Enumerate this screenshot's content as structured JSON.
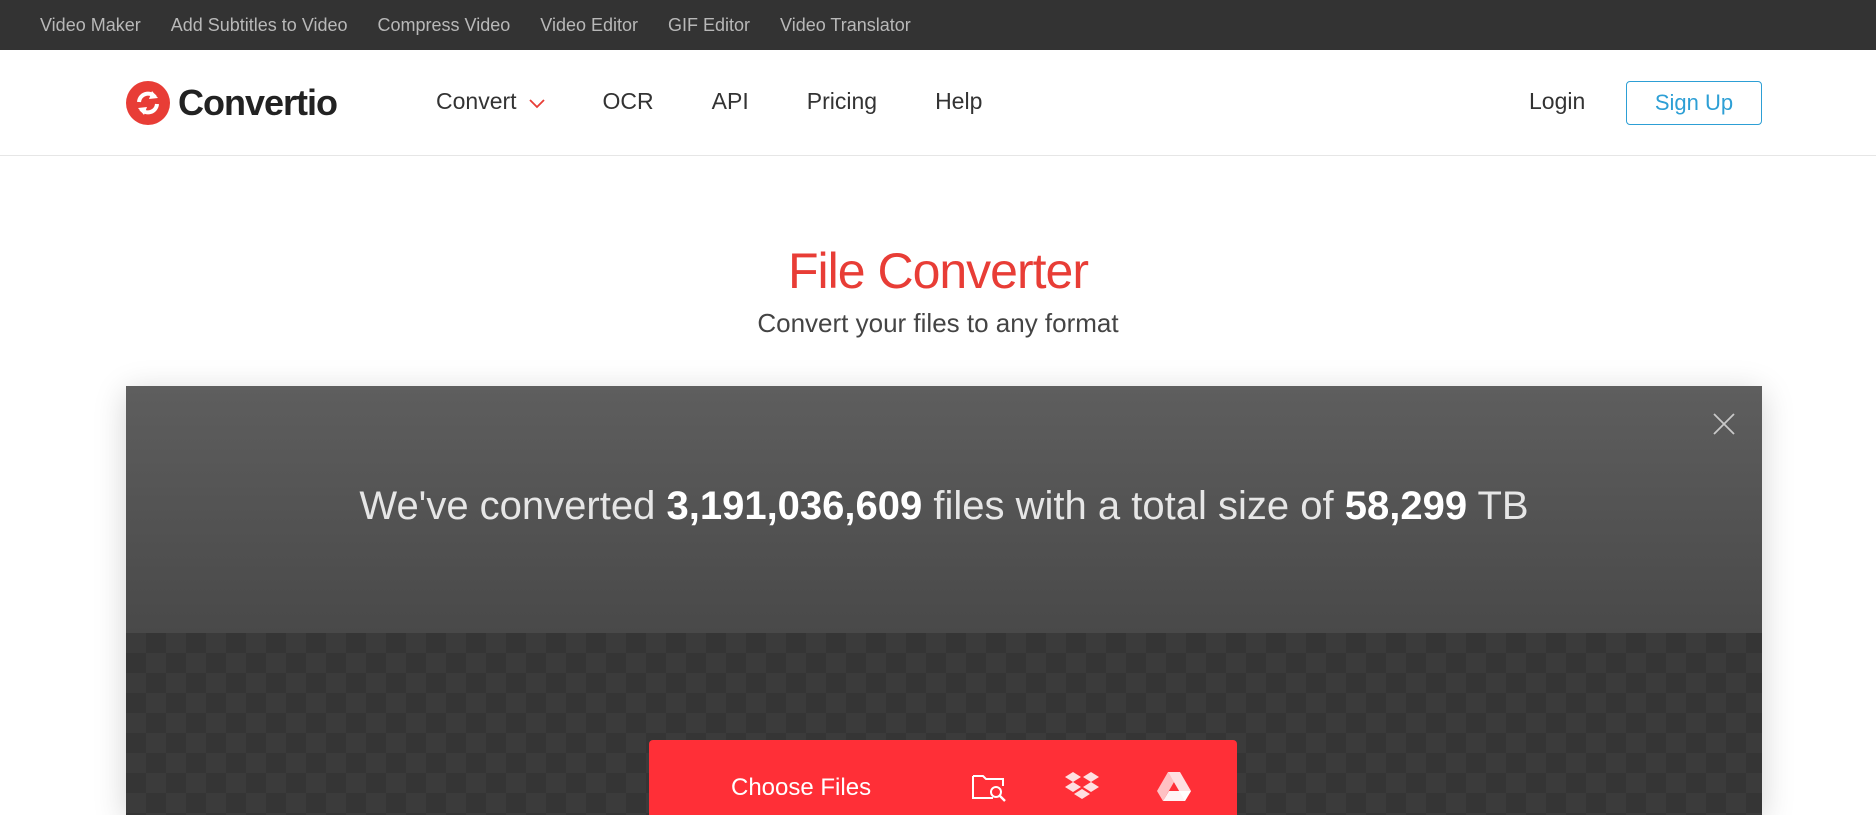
{
  "topbar": {
    "links": [
      "Video Maker",
      "Add Subtitles to Video",
      "Compress Video",
      "Video Editor",
      "GIF Editor",
      "Video Translator"
    ]
  },
  "header": {
    "logo_text": "Convertio",
    "nav": [
      "Convert",
      "OCR",
      "API",
      "Pricing",
      "Help"
    ],
    "login": "Login",
    "signup": "Sign Up"
  },
  "hero": {
    "title": "File Converter",
    "subtitle": "Convert your files to any format"
  },
  "stats": {
    "prefix": "We've converted",
    "files_count": "3,191,036,609",
    "middle": "files with a total size of",
    "total_size": "58,299",
    "unit": "TB"
  },
  "upload": {
    "choose_label": "Choose Files",
    "sources": [
      "folder-search-icon",
      "dropbox-icon",
      "google-drive-icon"
    ]
  },
  "colors": {
    "brand_red": "#e83d36",
    "button_red": "#ff2f37",
    "signup_blue": "#2d9fd5",
    "topbar_bg": "#333333"
  }
}
